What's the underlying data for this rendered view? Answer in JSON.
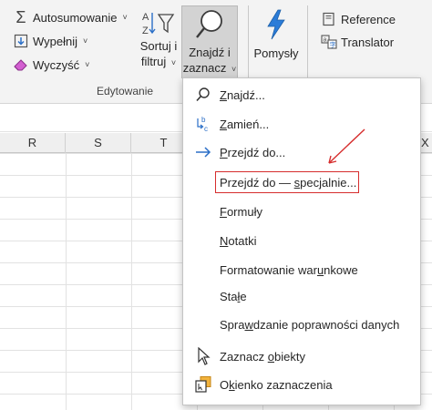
{
  "ribbon": {
    "editing": {
      "autosum_label": "Autosumowanie",
      "fill_label": "Wypełnij",
      "clear_label": "Wyczyść",
      "sort_line1": "Sortuj i",
      "sort_line2": "filtruj",
      "find_line1": "Znajdź i",
      "find_line2": "zaznacz",
      "group_label": "Edytowanie"
    },
    "ideas_label": "Pomysły",
    "language": {
      "reference_label": "Reference",
      "translator_label": "Translator"
    }
  },
  "sheet": {
    "columns": [
      "R",
      "S",
      "T",
      "X"
    ]
  },
  "menu": {
    "items": [
      {
        "pre": "",
        "u": "Z",
        "post": "najdź...",
        "icon": "search-icon"
      },
      {
        "pre": "",
        "u": "Z",
        "post": "amień...",
        "icon": "replace-icon"
      },
      {
        "pre": "",
        "u": "P",
        "post": "rzejdź do...",
        "icon": "arrow-right-icon"
      },
      {
        "pre": "Przejdź do — ",
        "u": "s",
        "post": "pecjalnie...",
        "icon": ""
      },
      {
        "pre": "",
        "u": "F",
        "post": "ormuły",
        "icon": ""
      },
      {
        "pre": "",
        "u": "N",
        "post": "otatki",
        "icon": ""
      },
      {
        "pre": "Formatowanie war",
        "u": "u",
        "post": "nkowe",
        "icon": ""
      },
      {
        "pre": "Sta",
        "u": "ł",
        "post": "e",
        "icon": ""
      },
      {
        "pre": "Spra",
        "u": "w",
        "post": "dzanie poprawności danych",
        "icon": ""
      },
      {
        "pre": "Zaznacz ",
        "u": "o",
        "post": "biekty",
        "icon": "cursor-select-icon"
      },
      {
        "pre": "O",
        "u": "k",
        "post": "ienko zaznaczenia",
        "icon": "selection-pane-icon"
      }
    ]
  },
  "colors": {
    "accent_blue": "#2b6fc7",
    "highlight_red": "#d62d2d"
  }
}
